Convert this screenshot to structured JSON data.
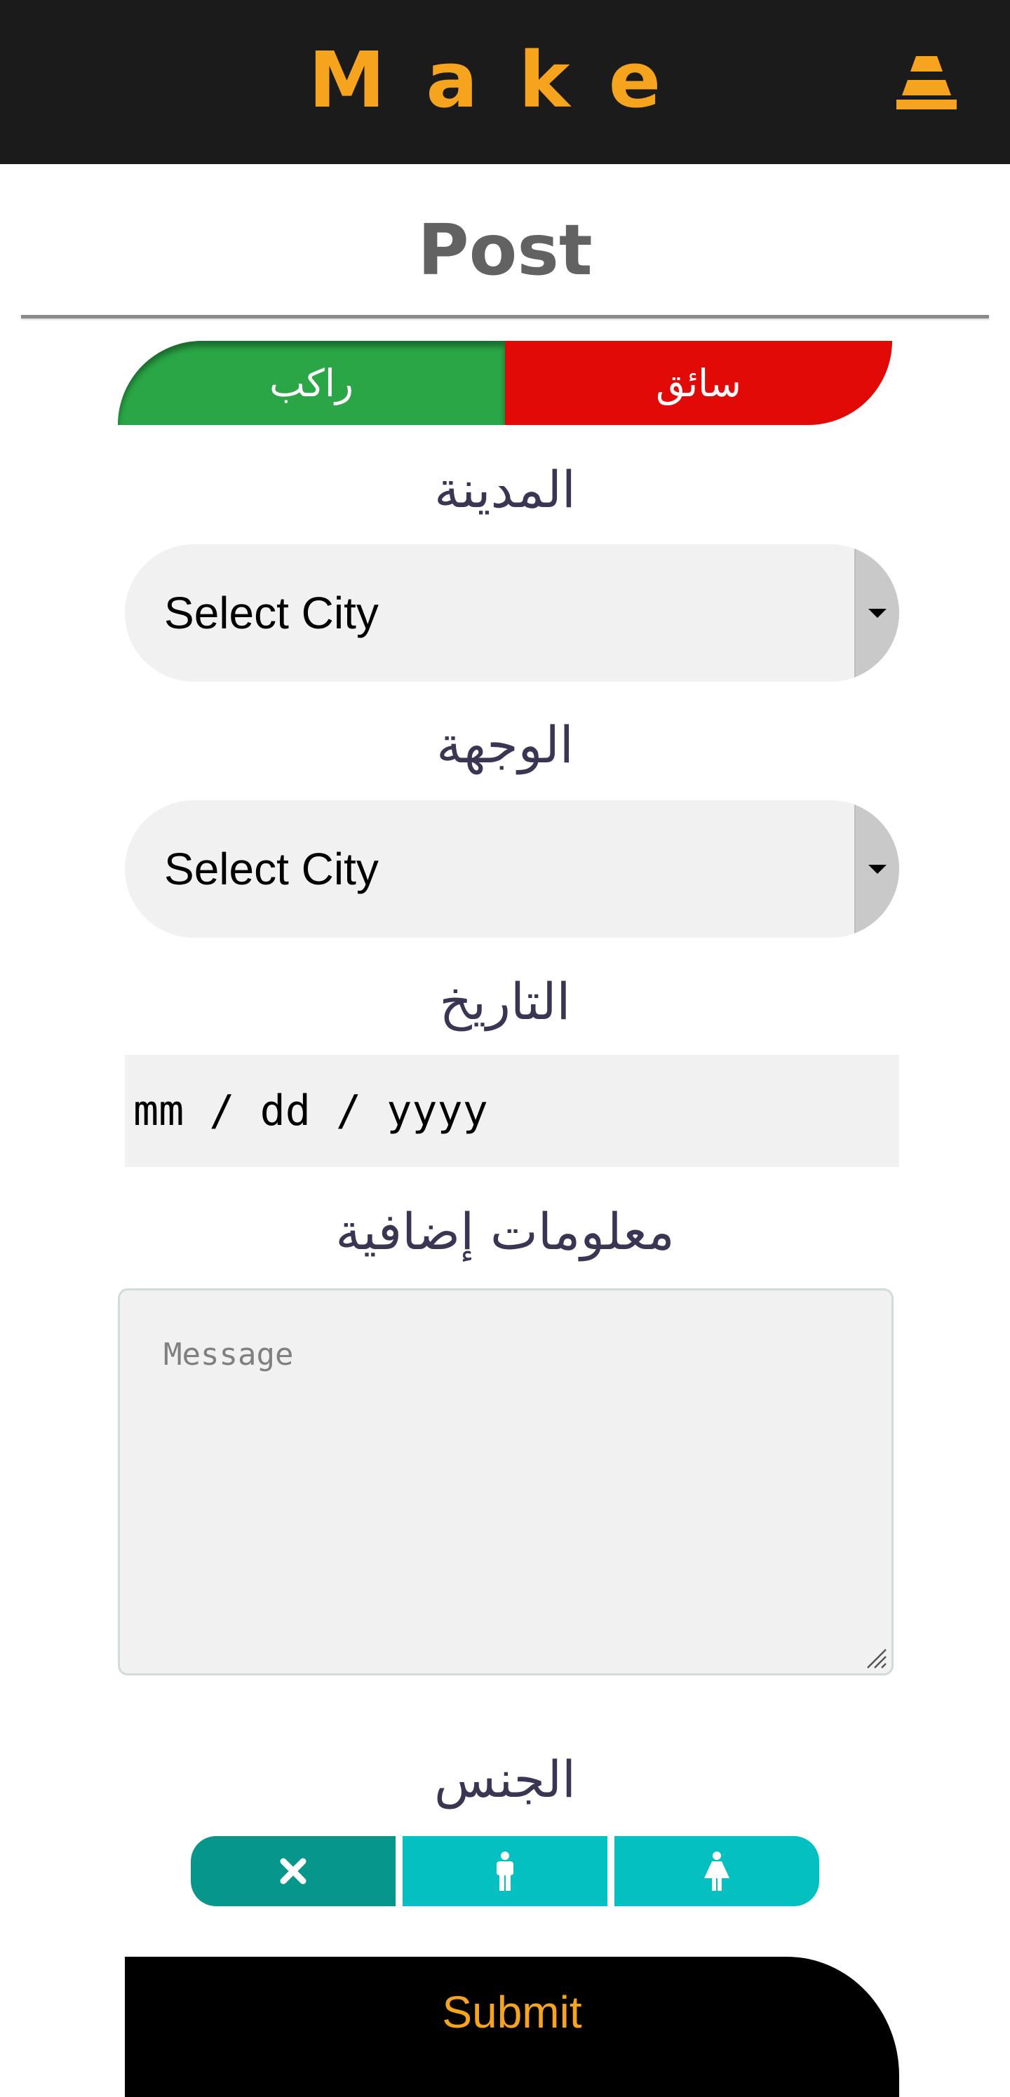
{
  "header": {
    "brand": "Make",
    "profile_icon": "cone-icon",
    "accent": "#f6a41d",
    "background": "#1b1b1b"
  },
  "page": {
    "title": "Post"
  },
  "role_toggle": {
    "rider_label": "راكب",
    "driver_label": "سائق",
    "rider_color": "#2aa646",
    "driver_color": "#e20a06",
    "selected": "rider"
  },
  "form": {
    "city": {
      "label": "المدينة",
      "value": "Select City"
    },
    "destination": {
      "label": "الوجهة",
      "value": "Select City"
    },
    "date": {
      "label": "التاريخ",
      "value": "mm / dd / yyyy"
    },
    "extra_info": {
      "label": "معلومات إضافية",
      "placeholder": "Message"
    },
    "gender": {
      "label": "الجنس",
      "options": [
        {
          "icon": "close-icon",
          "selected": true
        },
        {
          "icon": "male-icon",
          "selected": false
        },
        {
          "icon": "female-icon",
          "selected": false
        }
      ]
    },
    "submit_label": "Submit"
  }
}
